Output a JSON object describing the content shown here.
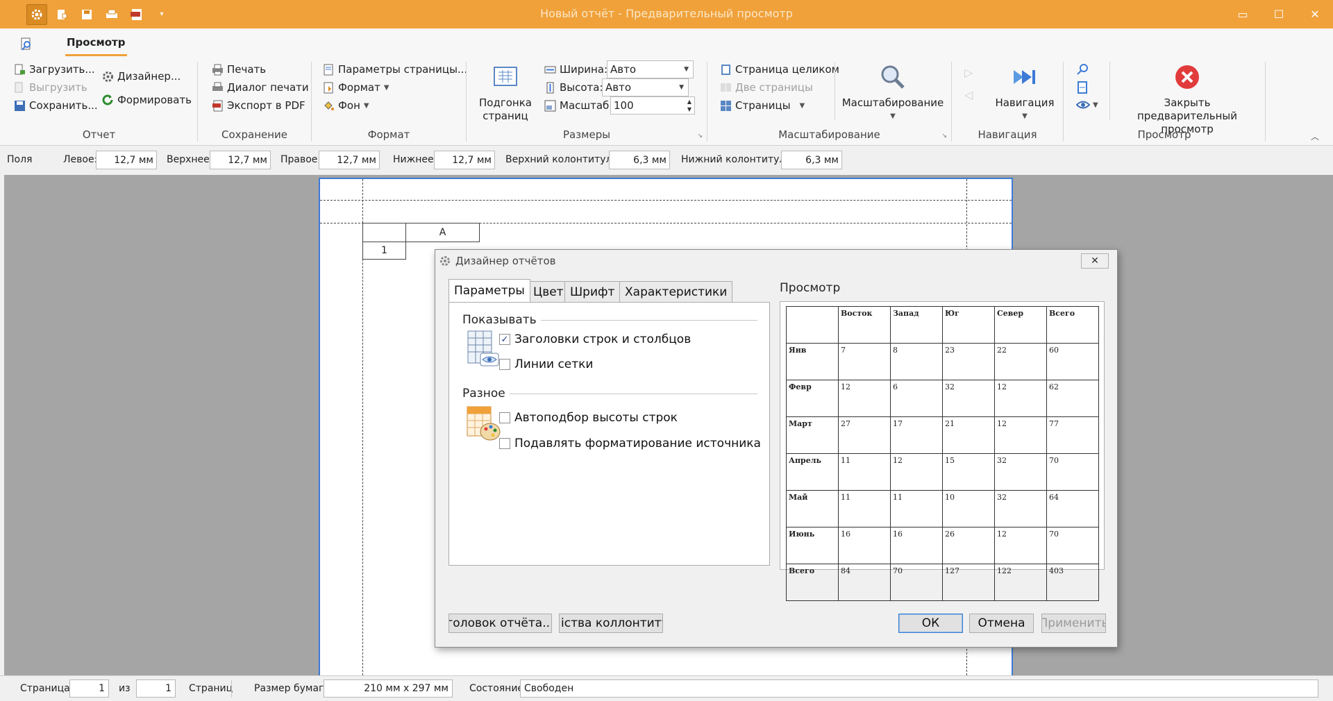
{
  "window": {
    "title": "Новый отчёт - Предварительный просмотр"
  },
  "ribbon": {
    "tab": "Просмотр",
    "report": {
      "load": "Загрузить...",
      "unload": "Выгрузить",
      "save": "Сохранить...",
      "designer": "Дизайнер...",
      "generate": "Формировать",
      "label": "Отчет"
    },
    "saving": {
      "print": "Печать",
      "print_dialog": "Диалог печати",
      "export_pdf": "Экспорт в PDF",
      "label": "Сохранение"
    },
    "format": {
      "page_params": "Параметры страницы...",
      "format": "Формат",
      "background": "Фон",
      "label": "Формат"
    },
    "sizes": {
      "fit_pages": "Подгонка страниц",
      "width_label": "Ширина:",
      "width_value": "Авто",
      "height_label": "Высота:",
      "height_value": "Авто",
      "scale_label": "Масштаб:",
      "scale_value": "100",
      "label": "Размеры"
    },
    "zoom": {
      "whole_page": "Страница целиком",
      "two_pages": "Две страницы",
      "pages": "Страницы",
      "zooming": "Масштабирование",
      "label": "Масштабирование"
    },
    "navigation": {
      "button": "Навигация",
      "label": "Навигация"
    },
    "view": {
      "close_preview": "Закрыть предварительный просмотр",
      "label": "Просмотр"
    }
  },
  "margins": {
    "title": "Поля",
    "left_label": "Левое:",
    "left": "12,7 мм",
    "top_label": "Верхнее:",
    "top": "12,7 мм",
    "right_label": "Правое:",
    "right": "12,7 мм",
    "bottom_label": "Нижнее:",
    "bottom": "12,7 мм",
    "header_label": "Верхний колонтитул:",
    "header": "6,3 мм",
    "footer_label": "Нижний колонтитул:",
    "footer": "6,3 мм"
  },
  "sheet": {
    "col_header": "A",
    "row_header": "1"
  },
  "dialog": {
    "title": "Дизайнер отчётов",
    "tabs": [
      "Параметры",
      "Цвет",
      "Шрифт",
      "Характеристики"
    ],
    "show_section": "Показывать",
    "show_headers": "Заголовки строк и столбцов",
    "show_headers_checked": true,
    "gridlines": "Линии сетки",
    "gridlines_checked": false,
    "misc_section": "Разное",
    "autofit_rows": "Автоподбор высоты строк",
    "autofit_rows_checked": false,
    "suppress_format": "Подавлять форматирование источника",
    "suppress_format_checked": false,
    "preview_label": "Просмотр",
    "preview_table": {
      "columns": [
        "",
        "Восток",
        "Запад",
        "Юг",
        "Север",
        "Всего"
      ],
      "rows": [
        [
          "Янв",
          "7",
          "8",
          "23",
          "22",
          "60"
        ],
        [
          "Февр",
          "12",
          "6",
          "32",
          "12",
          "62"
        ],
        [
          "Март",
          "27",
          "17",
          "21",
          "12",
          "77"
        ],
        [
          "Апрель",
          "11",
          "12",
          "15",
          "32",
          "70"
        ],
        [
          "Май",
          "11",
          "11",
          "10",
          "32",
          "64"
        ],
        [
          "Июнь",
          "16",
          "16",
          "26",
          "12",
          "70"
        ],
        [
          "Всего",
          "84",
          "70",
          "127",
          "122",
          "403"
        ]
      ]
    },
    "report_header_btn": "аголовок отчёта..",
    "footer_props_btn": "іства коллонтитул",
    "ok": "ОК",
    "cancel": "Отмена",
    "apply": "Применить"
  },
  "status": {
    "page_label": "Страница:",
    "page": "1",
    "of_label": "из",
    "total": "1",
    "pages_label": "Страниц",
    "paper_label": "Размер бумаги",
    "paper": "210 мм x 297 мм",
    "state_label": "Состояние",
    "state": "Свободен"
  },
  "colors": {
    "titlebar": "#f0a13a",
    "accent": "#f0a13a",
    "preview_bg": "#a5a5a5"
  }
}
